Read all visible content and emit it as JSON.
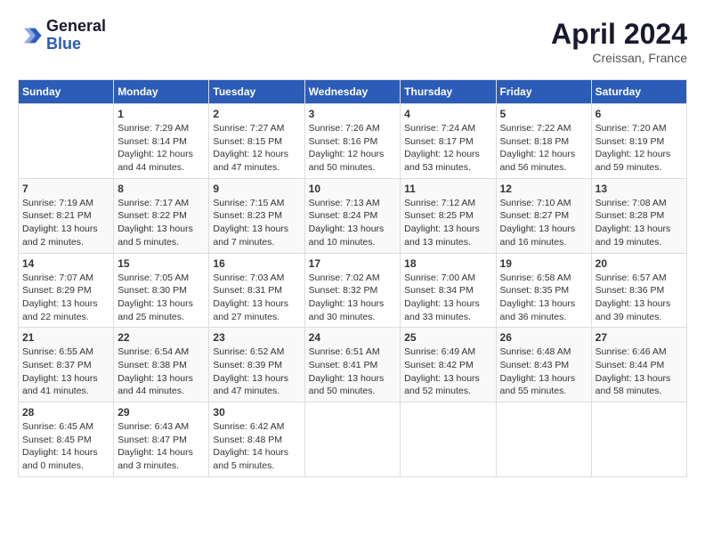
{
  "header": {
    "logo_line1": "General",
    "logo_line2": "Blue",
    "month_title": "April 2024",
    "location": "Creissan, France"
  },
  "columns": [
    "Sunday",
    "Monday",
    "Tuesday",
    "Wednesday",
    "Thursday",
    "Friday",
    "Saturday"
  ],
  "weeks": [
    [
      {
        "day": "",
        "info": ""
      },
      {
        "day": "1",
        "info": "Sunrise: 7:29 AM\nSunset: 8:14 PM\nDaylight: 12 hours and 44 minutes."
      },
      {
        "day": "2",
        "info": "Sunrise: 7:27 AM\nSunset: 8:15 PM\nDaylight: 12 hours and 47 minutes."
      },
      {
        "day": "3",
        "info": "Sunrise: 7:26 AM\nSunset: 8:16 PM\nDaylight: 12 hours and 50 minutes."
      },
      {
        "day": "4",
        "info": "Sunrise: 7:24 AM\nSunset: 8:17 PM\nDaylight: 12 hours and 53 minutes."
      },
      {
        "day": "5",
        "info": "Sunrise: 7:22 AM\nSunset: 8:18 PM\nDaylight: 12 hours and 56 minutes."
      },
      {
        "day": "6",
        "info": "Sunrise: 7:20 AM\nSunset: 8:19 PM\nDaylight: 12 hours and 59 minutes."
      }
    ],
    [
      {
        "day": "7",
        "info": "Sunrise: 7:19 AM\nSunset: 8:21 PM\nDaylight: 13 hours and 2 minutes."
      },
      {
        "day": "8",
        "info": "Sunrise: 7:17 AM\nSunset: 8:22 PM\nDaylight: 13 hours and 5 minutes."
      },
      {
        "day": "9",
        "info": "Sunrise: 7:15 AM\nSunset: 8:23 PM\nDaylight: 13 hours and 7 minutes."
      },
      {
        "day": "10",
        "info": "Sunrise: 7:13 AM\nSunset: 8:24 PM\nDaylight: 13 hours and 10 minutes."
      },
      {
        "day": "11",
        "info": "Sunrise: 7:12 AM\nSunset: 8:25 PM\nDaylight: 13 hours and 13 minutes."
      },
      {
        "day": "12",
        "info": "Sunrise: 7:10 AM\nSunset: 8:27 PM\nDaylight: 13 hours and 16 minutes."
      },
      {
        "day": "13",
        "info": "Sunrise: 7:08 AM\nSunset: 8:28 PM\nDaylight: 13 hours and 19 minutes."
      }
    ],
    [
      {
        "day": "14",
        "info": "Sunrise: 7:07 AM\nSunset: 8:29 PM\nDaylight: 13 hours and 22 minutes."
      },
      {
        "day": "15",
        "info": "Sunrise: 7:05 AM\nSunset: 8:30 PM\nDaylight: 13 hours and 25 minutes."
      },
      {
        "day": "16",
        "info": "Sunrise: 7:03 AM\nSunset: 8:31 PM\nDaylight: 13 hours and 27 minutes."
      },
      {
        "day": "17",
        "info": "Sunrise: 7:02 AM\nSunset: 8:32 PM\nDaylight: 13 hours and 30 minutes."
      },
      {
        "day": "18",
        "info": "Sunrise: 7:00 AM\nSunset: 8:34 PM\nDaylight: 13 hours and 33 minutes."
      },
      {
        "day": "19",
        "info": "Sunrise: 6:58 AM\nSunset: 8:35 PM\nDaylight: 13 hours and 36 minutes."
      },
      {
        "day": "20",
        "info": "Sunrise: 6:57 AM\nSunset: 8:36 PM\nDaylight: 13 hours and 39 minutes."
      }
    ],
    [
      {
        "day": "21",
        "info": "Sunrise: 6:55 AM\nSunset: 8:37 PM\nDaylight: 13 hours and 41 minutes."
      },
      {
        "day": "22",
        "info": "Sunrise: 6:54 AM\nSunset: 8:38 PM\nDaylight: 13 hours and 44 minutes."
      },
      {
        "day": "23",
        "info": "Sunrise: 6:52 AM\nSunset: 8:39 PM\nDaylight: 13 hours and 47 minutes."
      },
      {
        "day": "24",
        "info": "Sunrise: 6:51 AM\nSunset: 8:41 PM\nDaylight: 13 hours and 50 minutes."
      },
      {
        "day": "25",
        "info": "Sunrise: 6:49 AM\nSunset: 8:42 PM\nDaylight: 13 hours and 52 minutes."
      },
      {
        "day": "26",
        "info": "Sunrise: 6:48 AM\nSunset: 8:43 PM\nDaylight: 13 hours and 55 minutes."
      },
      {
        "day": "27",
        "info": "Sunrise: 6:46 AM\nSunset: 8:44 PM\nDaylight: 13 hours and 58 minutes."
      }
    ],
    [
      {
        "day": "28",
        "info": "Sunrise: 6:45 AM\nSunset: 8:45 PM\nDaylight: 14 hours and 0 minutes."
      },
      {
        "day": "29",
        "info": "Sunrise: 6:43 AM\nSunset: 8:47 PM\nDaylight: 14 hours and 3 minutes."
      },
      {
        "day": "30",
        "info": "Sunrise: 6:42 AM\nSunset: 8:48 PM\nDaylight: 14 hours and 5 minutes."
      },
      {
        "day": "",
        "info": ""
      },
      {
        "day": "",
        "info": ""
      },
      {
        "day": "",
        "info": ""
      },
      {
        "day": "",
        "info": ""
      }
    ]
  ]
}
